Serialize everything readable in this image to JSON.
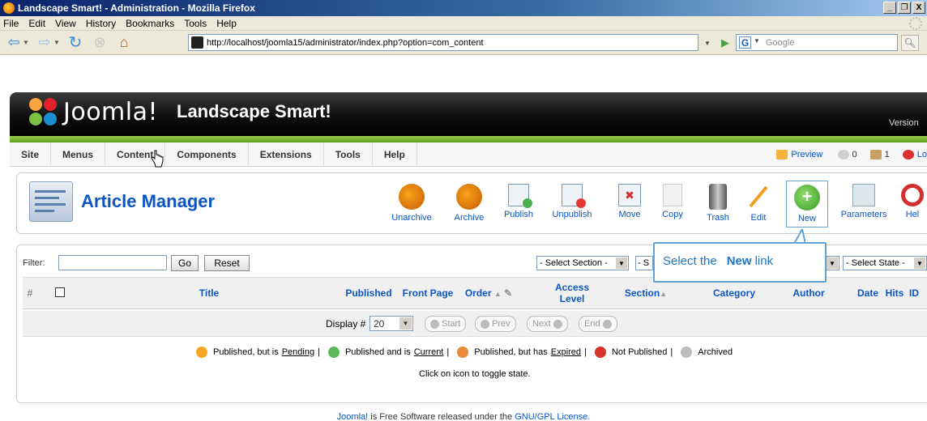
{
  "window": {
    "title": "Landscape Smart! - Administration - Mozilla Firefox",
    "buttons": [
      "_",
      "·",
      "X"
    ]
  },
  "browser_menu": [
    "File",
    "Edit",
    "View",
    "History",
    "Bookmarks",
    "Tools",
    "Help"
  ],
  "address": {
    "url": "http://localhost/joomla15/administrator/index.php?option=com_content",
    "search_engine": "Google",
    "search_placeholder": "Google"
  },
  "header": {
    "brand": "Joomla!",
    "site_name": "Landscape Smart!",
    "version": "Version"
  },
  "admin_menu": {
    "items": [
      "Site",
      "Menus",
      "Content",
      "Components",
      "Extensions",
      "Tools",
      "Help"
    ],
    "preview": "Preview",
    "messages_count": "0",
    "users_count": "1",
    "logout": "Lo"
  },
  "page": {
    "title": "Article Manager"
  },
  "toolbar": [
    {
      "name": "unarchive",
      "label": "Unarchive"
    },
    {
      "name": "archive",
      "label": "Archive"
    },
    {
      "name": "publish",
      "label": "Publish"
    },
    {
      "name": "unpublish",
      "label": "Unpublish"
    },
    {
      "name": "move",
      "label": "Move"
    },
    {
      "name": "copy",
      "label": "Copy"
    },
    {
      "name": "trash",
      "label": "Trash"
    },
    {
      "name": "edit",
      "label": "Edit"
    },
    {
      "name": "new",
      "label": "New"
    },
    {
      "name": "parameters",
      "label": "Parameters"
    },
    {
      "name": "help",
      "label": "Hel"
    }
  ],
  "filter": {
    "label": "Filter:",
    "value": "",
    "go_label": "Go",
    "reset_label": "Reset",
    "select_section": "- Select Section -",
    "select_category_partial": "- S",
    "select_author_partial": "",
    "select_state": "- Select State -"
  },
  "table": {
    "columns": [
      "#",
      "",
      "Title",
      "Published",
      "Front Page",
      "Order",
      "Access Level",
      "Section",
      "Category",
      "Author",
      "Date",
      "Hits",
      "ID"
    ]
  },
  "pagination": {
    "display_label": "Display #",
    "display_value": "20",
    "start": "Start",
    "prev": "Prev",
    "next": "Next",
    "end": "End"
  },
  "legend": {
    "pending_pre": "Published, but is",
    "pending_link": "Pending",
    "current_pre": "Published and is",
    "current_link": "Current",
    "expired_pre": "Published, but has",
    "expired_link": "Expired",
    "not_published": "Not Published",
    "archived": "Archived",
    "sep": "|",
    "toggle_note": "Click on icon to toggle state."
  },
  "callout": {
    "pre": "Select the",
    "bold": "New",
    "post": "link"
  },
  "footer": {
    "link1": "Joomla!",
    "middle": " is Free Software released under the ",
    "link2": "GNU/GPL License."
  },
  "colors": {
    "link_blue": "#0b55c4",
    "joomla_green": "#7cbf2f",
    "callout_blue": "#1d74c8"
  }
}
